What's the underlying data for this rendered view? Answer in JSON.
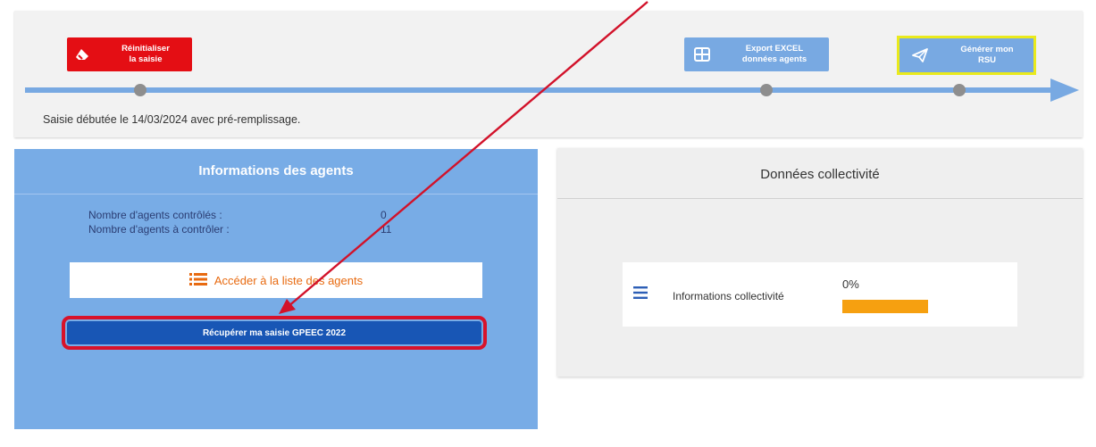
{
  "timeline": {
    "reset_label": "Réinitialiser\nla saisie",
    "export_label": "Export EXCEL\ndonnées agents",
    "rsu_label": "Générer mon\nRSU",
    "status_text": "Saisie débutée le 14/03/2024 avec pré-remplissage."
  },
  "agents_panel": {
    "title": "Informations des agents",
    "stats": [
      {
        "label": "Nombre d'agents contrôlés :",
        "value": "0"
      },
      {
        "label": "Nombre d'agents à contrôler :",
        "value": "11"
      }
    ],
    "list_button_label": "Accéder à la liste des agents",
    "gpeec_button_label": "Récupérer ma saisie GPEEC 2022"
  },
  "collectivite_panel": {
    "title": "Données collectivité",
    "item_label": "Informations collectivité",
    "progress_text": "0%",
    "progress_value": 0
  },
  "icons": [
    "eraser-icon",
    "table-icon",
    "send-icon",
    "list-icon",
    "menu-icon"
  ],
  "colors": {
    "accent_blue": "#78a9e2",
    "reset_red": "#e40e14",
    "dark_button": "#1856b5",
    "highlight_red": "#d8122a",
    "progress_orange": "#f6a010",
    "rsu_border": "#eaea1c"
  }
}
